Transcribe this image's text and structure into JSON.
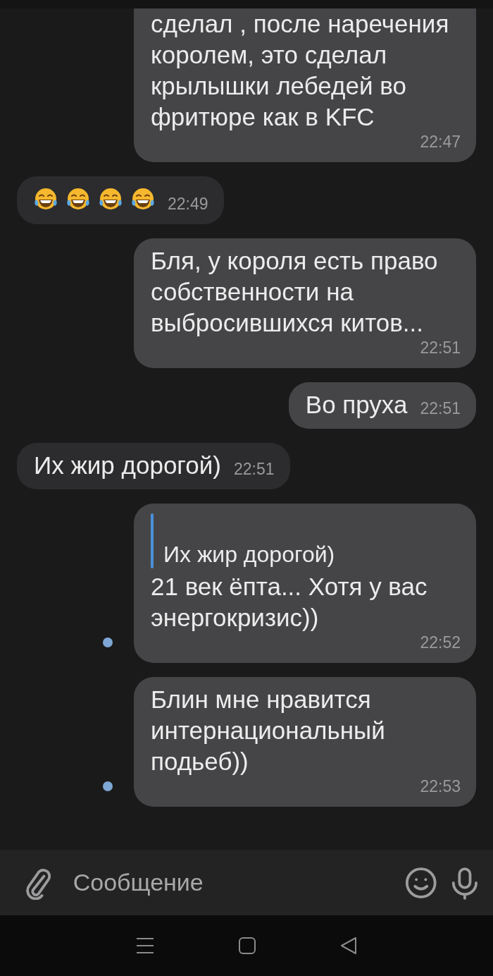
{
  "messages": [
    {
      "outgoing": true,
      "text": "сделал , после наречения королем, это сделал крылышки лебедей во фритюре как в KFC",
      "time": "22:47",
      "cut_top": true,
      "unread": false
    },
    {
      "outgoing": false,
      "kind": "emoji",
      "emojis": [
        {
          "kind": "tears-of-joy"
        },
        {
          "kind": "tears-of-joy"
        },
        {
          "kind": "tears-of-joy"
        },
        {
          "kind": "tears-of-joy"
        }
      ],
      "time": "22:49",
      "unread": false
    },
    {
      "outgoing": true,
      "text": "Бля, у короля есть право собственности на выбросившихся китов...",
      "time": "22:51",
      "unread": false
    },
    {
      "outgoing": true,
      "text": "Во пруха",
      "time": "22:51",
      "unread": false
    },
    {
      "outgoing": false,
      "text": "Их жир дорогой)",
      "time": "22:51",
      "unread": false
    },
    {
      "outgoing": true,
      "quote": "Их жир дорогой)",
      "text": "21 век ёпта... Хотя у вас энергокризис))",
      "time": "22:52",
      "unread": true
    },
    {
      "outgoing": true,
      "text": "Блин мне нравится интернациональный подьеб))",
      "time": "22:53",
      "unread": true
    }
  ],
  "composer": {
    "placeholder": "Сообщение"
  }
}
